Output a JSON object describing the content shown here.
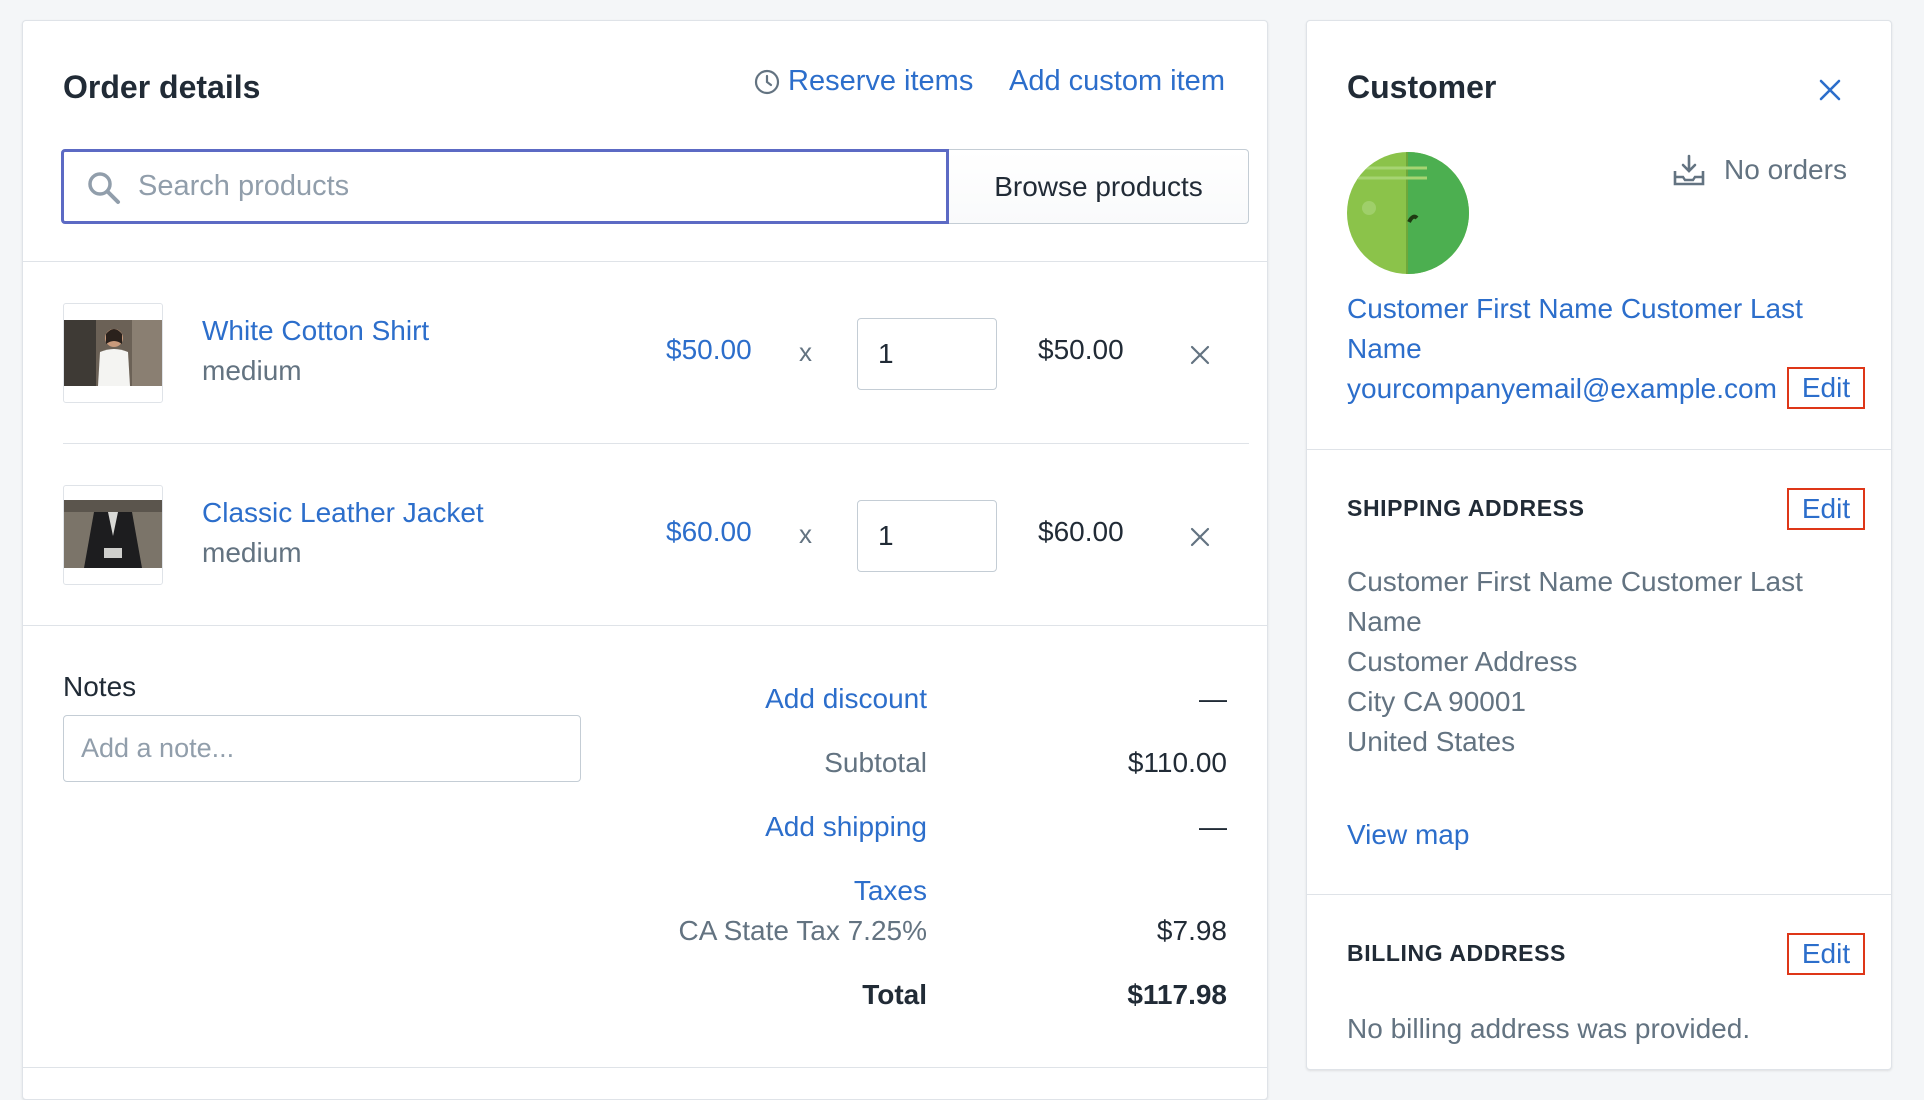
{
  "order": {
    "title": "Order details",
    "reserve_items": "Reserve items",
    "add_custom_item": "Add custom item",
    "search_placeholder": "Search products",
    "browse_button": "Browse products",
    "items": [
      {
        "name": "White Cotton Shirt",
        "variant": "medium",
        "price": "$50.00",
        "times": "x",
        "quantity": "1",
        "total": "$50.00"
      },
      {
        "name": "Classic Leather Jacket",
        "variant": "medium",
        "price": "$60.00",
        "times": "x",
        "quantity": "1",
        "total": "$60.00"
      }
    ],
    "notes_label": "Notes",
    "notes_placeholder": "Add a note...",
    "summary": {
      "discount_label": "Add discount",
      "discount_value": "—",
      "subtotal_label": "Subtotal",
      "subtotal_value": "$110.00",
      "shipping_label": "Add shipping",
      "shipping_value": "—",
      "taxes_label": "Taxes",
      "tax_line_label": "CA State Tax 7.25%",
      "tax_line_value": "$7.98",
      "total_label": "Total",
      "total_value": "$117.98"
    }
  },
  "customer": {
    "title": "Customer",
    "orders_status": "No orders",
    "name_line1": "Customer First Name Customer Last",
    "name_line2": "Name",
    "email": "yourcompanyemail@example.com",
    "edit_label": "Edit",
    "shipping": {
      "heading": "SHIPPING ADDRESS",
      "edit_label": "Edit",
      "lines": [
        "Customer First Name Customer Last",
        "Name",
        "Customer Address",
        "City CA 90001",
        "United States"
      ],
      "view_map": "View map"
    },
    "billing": {
      "heading": "BILLING ADDRESS",
      "edit_label": "Edit",
      "text": "No billing address was provided."
    }
  },
  "colors": {
    "link": "#2c6ecb",
    "highlight_border": "#de3618",
    "search_focus": "#5c6ac4",
    "avatar_light": "#8bc34a",
    "avatar_dark": "#4caf50"
  },
  "icons": [
    "clock-icon",
    "search-icon",
    "close-icon",
    "inbox-download-icon"
  ]
}
